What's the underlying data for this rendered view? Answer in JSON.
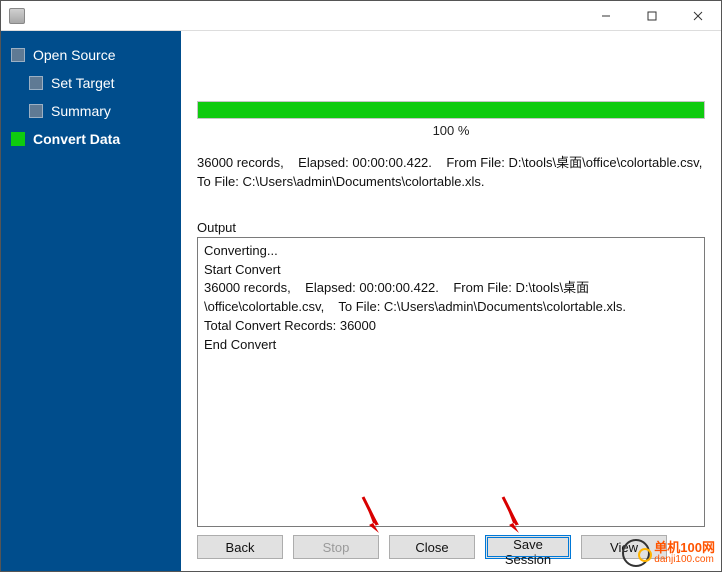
{
  "sidebar": {
    "items": [
      {
        "label": "Open Source",
        "active": false
      },
      {
        "label": "Set Target",
        "active": false
      },
      {
        "label": "Summary",
        "active": false
      },
      {
        "label": "Convert Data",
        "active": true
      }
    ]
  },
  "progress": {
    "percent_text": "100 %",
    "percent_value": 100
  },
  "summary_text": "36000 records,    Elapsed: 00:00:00.422.    From File: D:\\tools\\桌面\\office\\colortable.csv,    To File: C:\\Users\\admin\\Documents\\colortable.xls.",
  "output": {
    "label": "Output",
    "lines": [
      "Converting...",
      "Start Convert",
      "36000 records,    Elapsed: 00:00:00.422.    From File: D:\\tools\\桌面\\office\\colortable.csv,    To File: C:\\Users\\admin\\Documents\\colortable.xls.",
      "Total Convert Records: 36000",
      "End Convert"
    ]
  },
  "buttons": {
    "back": "Back",
    "stop": "Stop",
    "close": "Close",
    "save_session": "Save Session",
    "view": "View"
  },
  "watermark": {
    "name": "单机100网",
    "url": "danji100.com"
  }
}
